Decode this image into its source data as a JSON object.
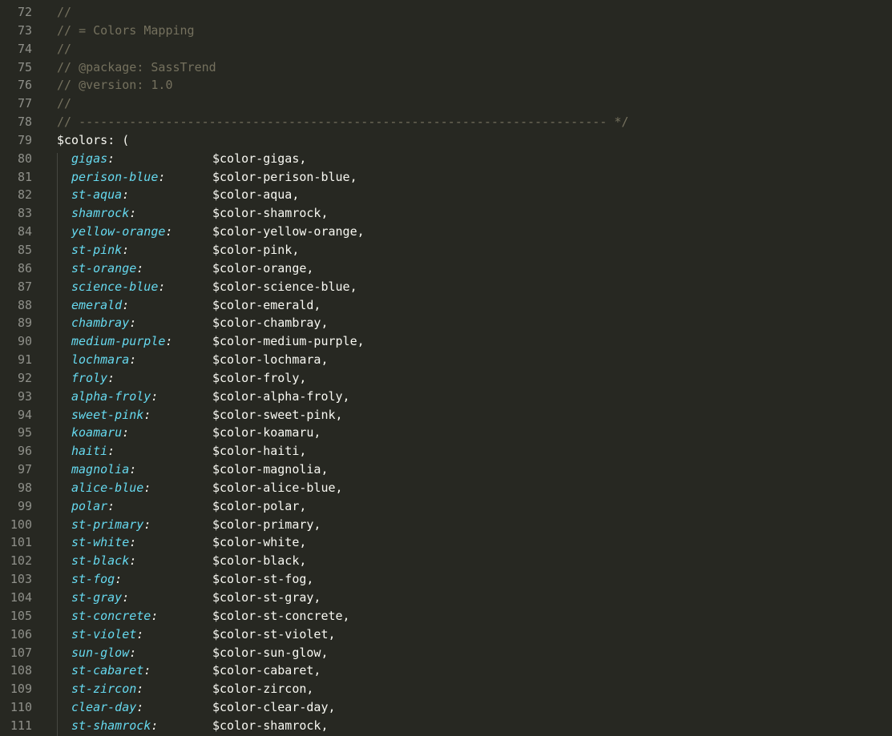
{
  "editor": {
    "lines": [
      {
        "num": "72",
        "kind": "comment",
        "text": "//"
      },
      {
        "num": "73",
        "kind": "comment",
        "text": "// = Colors Mapping"
      },
      {
        "num": "74",
        "kind": "comment",
        "text": "//"
      },
      {
        "num": "75",
        "kind": "comment",
        "text": "// @package: SassTrend"
      },
      {
        "num": "76",
        "kind": "comment",
        "text": "// @version: 1.0"
      },
      {
        "num": "77",
        "kind": "comment",
        "text": "//"
      },
      {
        "num": "78",
        "kind": "comment",
        "text": "// ------------------------------------------------------------------------- */"
      },
      {
        "num": "79",
        "kind": "open",
        "text": "$colors: ("
      },
      {
        "num": "80",
        "kind": "pair",
        "key": "gigas",
        "value": "$color-gigas,"
      },
      {
        "num": "81",
        "kind": "pair",
        "key": "perison-blue",
        "value": "$color-perison-blue,"
      },
      {
        "num": "82",
        "kind": "pair",
        "key": "st-aqua",
        "value": "$color-aqua,"
      },
      {
        "num": "83",
        "kind": "pair",
        "key": "shamrock",
        "value": "$color-shamrock,"
      },
      {
        "num": "84",
        "kind": "pair",
        "key": "yellow-orange",
        "value": "$color-yellow-orange,"
      },
      {
        "num": "85",
        "kind": "pair",
        "key": "st-pink",
        "value": "$color-pink,"
      },
      {
        "num": "86",
        "kind": "pair",
        "key": "st-orange",
        "value": "$color-orange,"
      },
      {
        "num": "87",
        "kind": "pair",
        "key": "science-blue",
        "value": "$color-science-blue,"
      },
      {
        "num": "88",
        "kind": "pair",
        "key": "emerald",
        "value": "$color-emerald,"
      },
      {
        "num": "89",
        "kind": "pair",
        "key": "chambray",
        "value": "$color-chambray,"
      },
      {
        "num": "90",
        "kind": "pair",
        "key": "medium-purple",
        "value": "$color-medium-purple,"
      },
      {
        "num": "91",
        "kind": "pair",
        "key": "lochmara",
        "value": "$color-lochmara,"
      },
      {
        "num": "92",
        "kind": "pair",
        "key": "froly",
        "value": "$color-froly,"
      },
      {
        "num": "93",
        "kind": "pair",
        "key": "alpha-froly",
        "value": "$color-alpha-froly,"
      },
      {
        "num": "94",
        "kind": "pair",
        "key": "sweet-pink",
        "value": "$color-sweet-pink,"
      },
      {
        "num": "95",
        "kind": "pair",
        "key": "koamaru",
        "value": "$color-koamaru,"
      },
      {
        "num": "96",
        "kind": "pair",
        "key": "haiti",
        "value": "$color-haiti,"
      },
      {
        "num": "97",
        "kind": "pair",
        "key": "magnolia",
        "value": "$color-magnolia,"
      },
      {
        "num": "98",
        "kind": "pair",
        "key": "alice-blue",
        "value": "$color-alice-blue,"
      },
      {
        "num": "99",
        "kind": "pair",
        "key": "polar",
        "value": "$color-polar,"
      },
      {
        "num": "100",
        "kind": "pair",
        "key": "st-primary",
        "value": "$color-primary,"
      },
      {
        "num": "101",
        "kind": "pair",
        "key": "st-white",
        "value": "$color-white,"
      },
      {
        "num": "102",
        "kind": "pair",
        "key": "st-black",
        "value": "$color-black,"
      },
      {
        "num": "103",
        "kind": "pair",
        "key": "st-fog",
        "value": "$color-st-fog,"
      },
      {
        "num": "104",
        "kind": "pair",
        "key": "st-gray",
        "value": "$color-st-gray,"
      },
      {
        "num": "105",
        "kind": "pair",
        "key": "st-concrete",
        "value": "$color-st-concrete,"
      },
      {
        "num": "106",
        "kind": "pair",
        "key": "st-violet",
        "value": "$color-st-violet,"
      },
      {
        "num": "107",
        "kind": "pair",
        "key": "sun-glow",
        "value": "$color-sun-glow,"
      },
      {
        "num": "108",
        "kind": "pair",
        "key": "st-cabaret",
        "value": "$color-cabaret,"
      },
      {
        "num": "109",
        "kind": "pair",
        "key": "st-zircon",
        "value": "$color-zircon,"
      },
      {
        "num": "110",
        "kind": "pair",
        "key": "clear-day",
        "value": "$color-clear-day,"
      },
      {
        "num": "111",
        "kind": "pair",
        "key": "st-shamrock",
        "value": "$color-shamrock,"
      }
    ]
  },
  "theme": {
    "background": "#272822",
    "comment": "#75715e",
    "key": "#66d9ef",
    "text": "#f8f8f2",
    "gutter_text": "#8f908a"
  }
}
